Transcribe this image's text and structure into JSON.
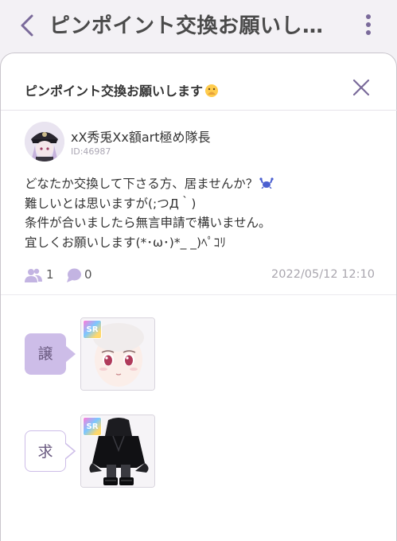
{
  "header": {
    "title": "ピンポイント交換お願いし…"
  },
  "dialog": {
    "title": "ピンポイント交換お願いします"
  },
  "user": {
    "name": "xX秀兎Xx額art極め隊長",
    "id": "ID:46987"
  },
  "post": {
    "line1": "どなたか交換して下さる方、居ませんか？",
    "line2": "難しいとは思いますが(;つД｀)",
    "line3": "条件が合いましたら無言申請で構いません。",
    "line4": "宜しくお願いします(*･ω･)*_ _)ﾍﾟｺﾘ"
  },
  "stats": {
    "participants": "1",
    "comments": "0",
    "datetime": "2022/05/12 12:10"
  },
  "trade": {
    "give_label": "譲",
    "want_label": "求",
    "give_item": {
      "rarity": "SR"
    },
    "want_item": {
      "rarity": "SR"
    }
  },
  "colors": {
    "accent": "#cdbde8",
    "accent_text": "#6a5a80",
    "icon": "#c3b4e2"
  },
  "icons": [
    "back-chevron-icon",
    "more-vertical-icon",
    "close-icon",
    "people-icon",
    "comment-icon",
    "crying-emoji-icon",
    "crab-emoji-icon"
  ]
}
